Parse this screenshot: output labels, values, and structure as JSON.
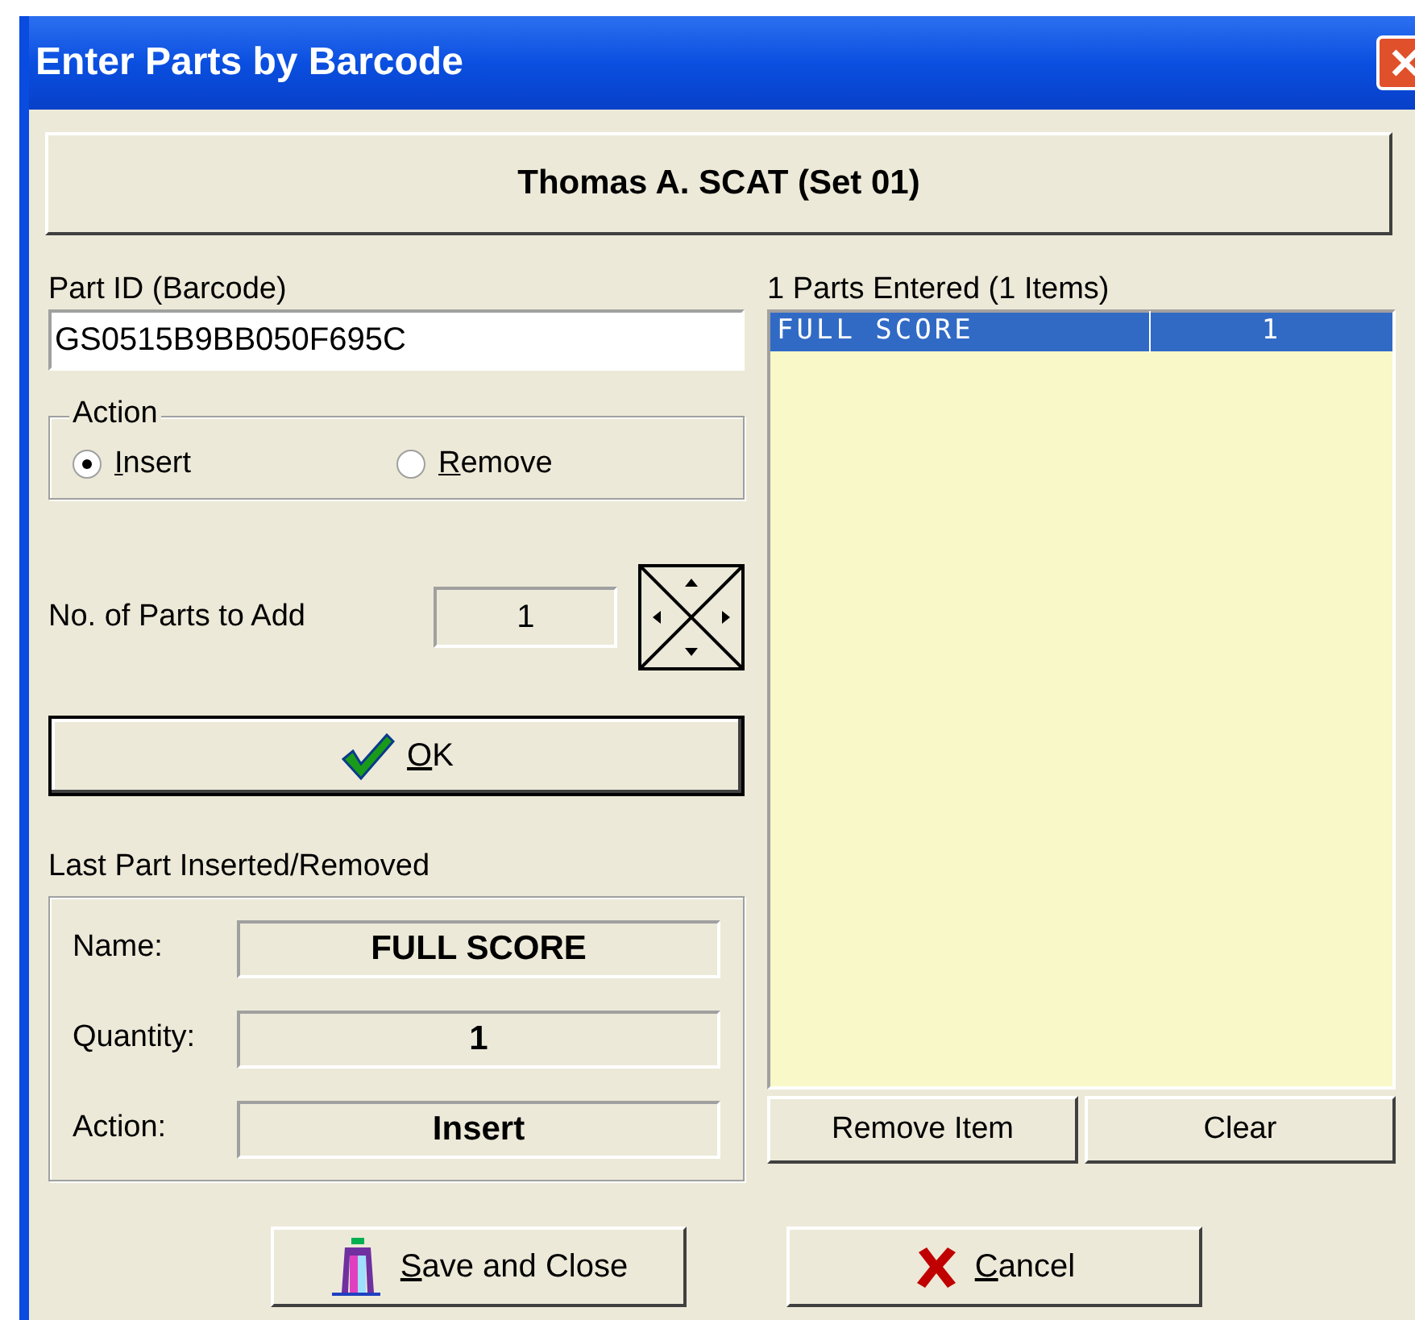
{
  "window": {
    "title": "Enter Parts by Barcode"
  },
  "header": "Thomas A. SCAT (Set 01)",
  "part_id": {
    "label": "Part ID (Barcode)",
    "value": "GS0515B9BB050F695C"
  },
  "action": {
    "label": "Action",
    "options": [
      {
        "label": "Insert",
        "selected": true
      },
      {
        "label": "Remove",
        "selected": false
      }
    ]
  },
  "quantity": {
    "label": "No. of Parts to Add",
    "value": "1"
  },
  "ok_button": "OK",
  "last_part": {
    "label": "Last Part Inserted/Removed",
    "fields": [
      {
        "label": "Name:",
        "value": "FULL SCORE"
      },
      {
        "label": "Quantity:",
        "value": "1"
      },
      {
        "label": "Action:",
        "value": "Insert"
      }
    ]
  },
  "parts_list": {
    "label": "1 Parts Entered (1 Items)",
    "rows": [
      {
        "name": "FULL SCORE",
        "quantity": "1",
        "selected": true
      }
    ]
  },
  "list_buttons": [
    "Remove Item",
    "Clear"
  ],
  "buttons": [
    {
      "kind": "save",
      "label": "Save and Close"
    },
    {
      "kind": "cancel",
      "label": "Cancel"
    }
  ]
}
